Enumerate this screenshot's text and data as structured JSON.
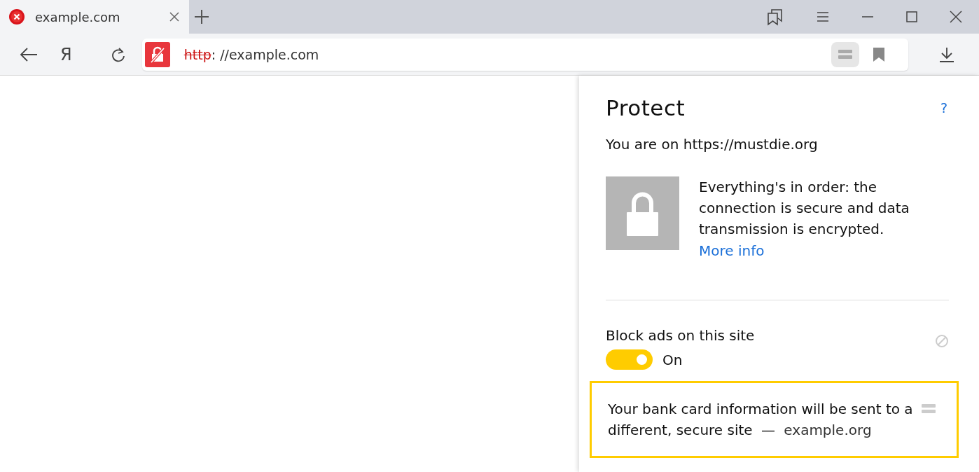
{
  "tabs": [
    {
      "title": "example.com",
      "selected": true,
      "error": true
    }
  ],
  "toolbar": {
    "home_button": "Я",
    "url_scheme": "http",
    "url_rest": ": //example.com",
    "scheme_insecure": true
  },
  "panel": {
    "title": "Protect",
    "help": "?",
    "site_line": "You are on https://mustdie.org",
    "status": "Everything's in order: the connection is secure and data transmission is encrypted.",
    "more_link": "More info",
    "block_ads": {
      "label": "Block ads on this site",
      "on": true,
      "state_label": "On"
    },
    "notice": {
      "text": "Your bank card information will be sent to a different, secure site",
      "dash": "—",
      "domain": "example.org",
      "highlighted": true
    }
  }
}
